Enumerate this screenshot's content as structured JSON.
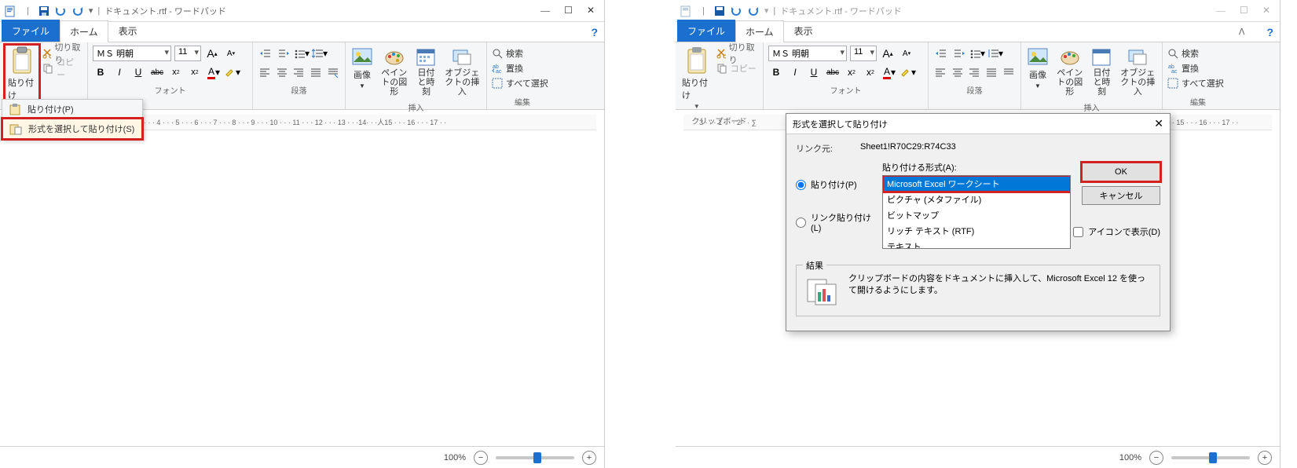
{
  "app_title": "ドキュメント.rtf - ワードパッド",
  "tabs": {
    "file": "ファイル",
    "home": "ホーム",
    "view": "表示"
  },
  "clipboard": {
    "paste": "貼り付け",
    "cut": "切り取り",
    "copy": "コピー",
    "group": "クリップボード"
  },
  "font": {
    "name": "ＭＳ 明朝",
    "size": "11",
    "group": "フォント"
  },
  "paragraph_group": "段落",
  "insert": {
    "image": "画像",
    "paint": "ペイントの図形",
    "datetime": "日付と時刻",
    "object": "オブジェクトの挿入",
    "group": "挿入"
  },
  "edit": {
    "find": "検索",
    "replace": "置換",
    "selectall": "すべて選択",
    "group": "編集"
  },
  "paste_menu": {
    "paste": "貼り付け(P)",
    "paste_special": "形式を選択して貼り付け(S)"
  },
  "status": {
    "zoom": "100%"
  },
  "dialog": {
    "title": "形式を選択して貼り付け",
    "source_label": "リンク元:",
    "source_value": "Sheet1!R70C29:R74C33",
    "format_label": "貼り付ける形式(A):",
    "paste_radio": "貼り付け(P)",
    "link_radio": "リンク貼り付け(L)",
    "options": [
      "Microsoft Excel ワークシート",
      "ピクチャ (メタファイル)",
      "ビットマップ",
      "リッチ テキスト (RTF)",
      "テキスト"
    ],
    "ok": "OK",
    "cancel": "キャンセル",
    "icon_check": "アイコンで表示(D)",
    "result_label": "結果",
    "result_text": "クリップボードの内容をドキュメントに挿入して、Microsoft Excel 12 を使って開けるようにします。"
  },
  "ruler_left": "3 · · · 2 · · · 1 · · · ∑ · · · 1 · · · 2 · · · 3 · · · 4 · · · 5 · · · 6 · · · 7 · · · 8 · · · 9 · · · 10 · · · 11 · · · 12 · · · 13 · · ·14· · ·人15 · · · 16 · · · 17 · ·",
  "ruler_right_a": "3 · · · 1 · · · 2 · · ∑",
  "ruler_right_b": "·14· · · 15 · · · 16 · · · 17 · ·"
}
